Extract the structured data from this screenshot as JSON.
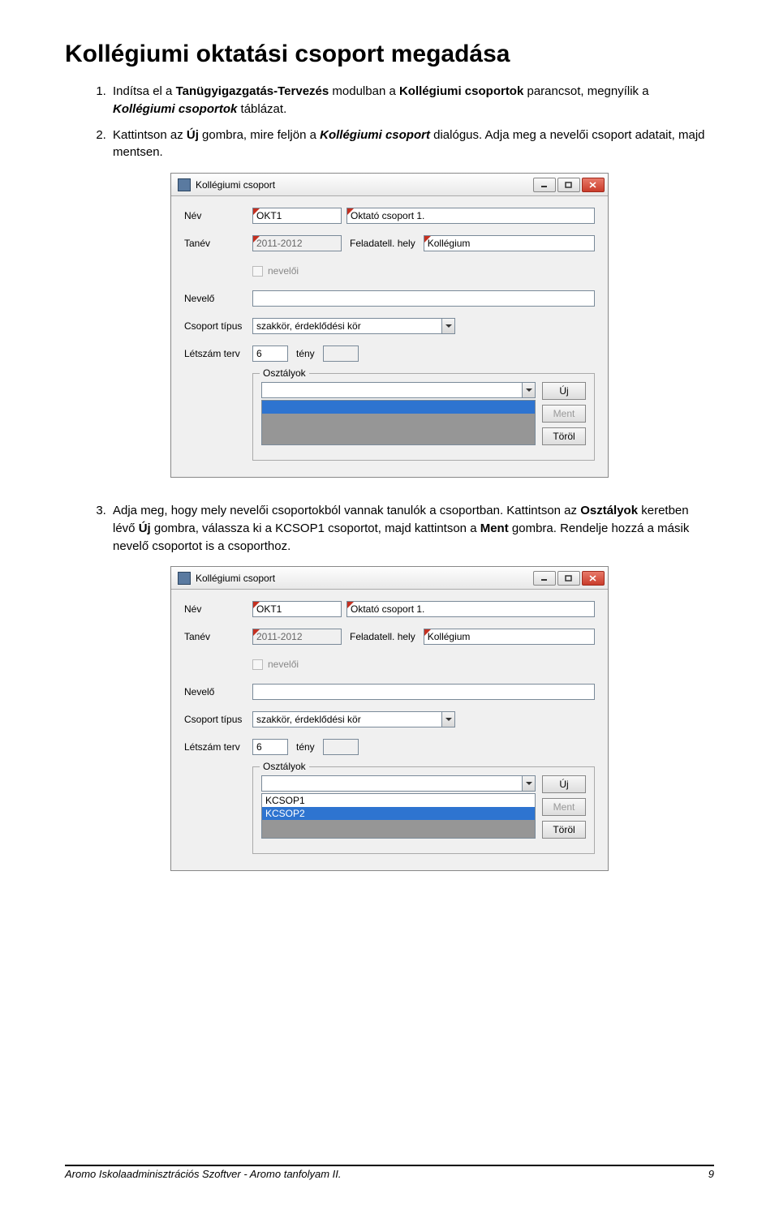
{
  "heading": "Kollégiumi oktatási csoport megadása",
  "steps": {
    "s1_a": "Indítsa el a ",
    "s1_b": "Tanügyigazgatás-Tervezés",
    "s1_c": " modulban a ",
    "s1_d": "Kollégiumi csoportok",
    "s1_e": " parancsot, megnyílik a ",
    "s1_f": "Kollégiumi csoportok",
    "s1_g": " táblázat.",
    "s2_a": "Kattintson az ",
    "s2_b": "Új",
    "s2_c": " gombra, mire feljön a ",
    "s2_d": "Kollégiumi csoport",
    "s2_e": " dialógus. Adja meg a nevelői csoport adatait, majd mentsen.",
    "s3_a": "Adja meg, hogy mely nevelői csoportokból vannak tanulók a csoportban. Kattintson az ",
    "s3_b": "Osztályok",
    "s3_c": " keretben lévő ",
    "s3_d": "Új",
    "s3_e": " gombra, válassza ki a KCSOP1 csoportot, majd kattintson a ",
    "s3_f": "Ment",
    "s3_g": " gombra. Rendelje hozzá a másik nevelő csoportot is a csoporthoz."
  },
  "dialog": {
    "title": "Kollégiumi csoport",
    "labels": {
      "nev": "Név",
      "tanev": "Tanév",
      "feladhely": "Feladatell. hely",
      "neveloicb": "nevelői",
      "nevelo": "Nevelő",
      "cstipus": "Csoport típus",
      "letszterv": "Létszám terv",
      "teny": "tény",
      "osztalyok": "Osztályok"
    },
    "values": {
      "kod": "OKT1",
      "nev": "Oktató csoport 1.",
      "tanev": "2011-2012",
      "feladhely": "Kollégium",
      "cstipus": "szakkör, érdeklődési kör",
      "letszam": "6"
    },
    "buttons": {
      "uj": "Új",
      "ment": "Ment",
      "torol": "Töröl"
    },
    "list2": {
      "combo_sel": "",
      "item1": "KCSOP1",
      "item2": "KCSOP2"
    }
  },
  "footer": {
    "left": "Aromo Iskolaadminisztrációs Szoftver - Aromo tanfolyam II.",
    "page": "9"
  }
}
